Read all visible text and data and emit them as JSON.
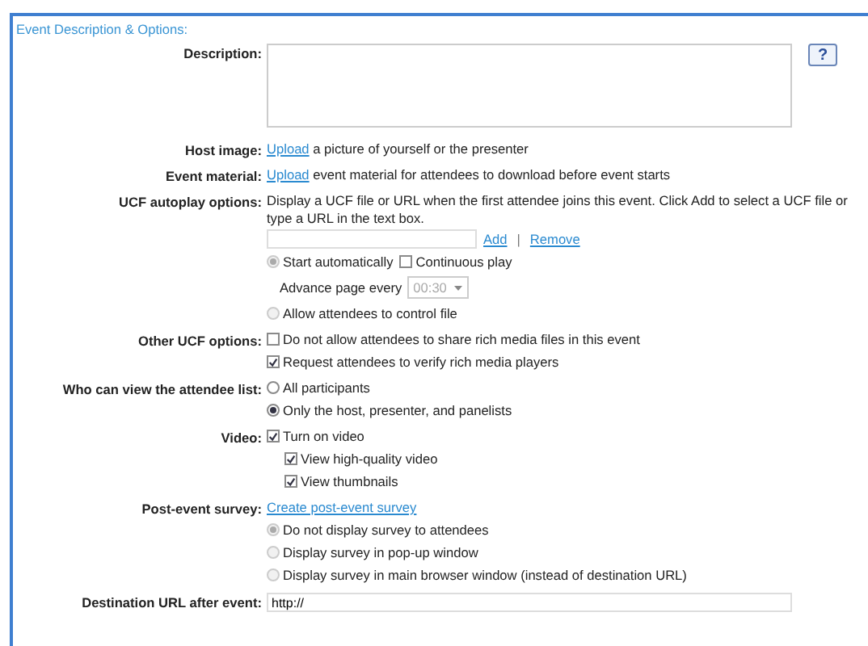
{
  "section_title": "Event Description & Options:",
  "help_button": "?",
  "rows": [
    {
      "label": "Description:",
      "lines": [
        {
          "items": [
            {
              "kind": "textarea"
            }
          ]
        }
      ]
    },
    {
      "label": "Host image:",
      "lines": [
        {
          "items": [
            {
              "kind": "link_text",
              "link": "Upload",
              "text": "a picture of yourself or the presenter"
            }
          ]
        }
      ]
    },
    {
      "label": "Event material:",
      "lines": [
        {
          "items": [
            {
              "kind": "link_text",
              "link": "Upload",
              "text": "event material for attendees to download before event starts"
            }
          ]
        }
      ]
    },
    {
      "label": "UCF autoplay options:",
      "lines": [
        {
          "items": [
            {
              "kind": "note",
              "text": "Display a UCF file or URL when the first attendee joins this event. Click Add to select a UCF file or type a URL in the text box."
            }
          ]
        },
        {
          "items": [
            {
              "kind": "input"
            },
            {
              "kind": "link",
              "text": "Add"
            },
            {
              "kind": "separator",
              "text": "|"
            },
            {
              "kind": "link",
              "text": "Remove"
            }
          ]
        },
        {
          "items": [
            {
              "kind": "radio",
              "label": "Start automatically",
              "checked": true,
              "disabled": true
            },
            {
              "kind": "checkbox",
              "label": "Continuous play",
              "checked": false,
              "disabled": false
            }
          ]
        },
        {
          "items": [
            {
              "kind": "select",
              "label": "Advance page every",
              "value": "00:30",
              "disabled": true
            }
          ]
        },
        {
          "items": [
            {
              "kind": "radio",
              "label": "Allow attendees to control file",
              "checked": false,
              "disabled": true
            }
          ]
        }
      ]
    },
    {
      "label": "Other UCF options:",
      "lines": [
        {
          "items": [
            {
              "kind": "checkbox",
              "label": "Do not allow attendees to share rich media files in this event",
              "checked": false,
              "disabled": false
            }
          ]
        },
        {
          "items": [
            {
              "kind": "checkbox",
              "label": "Request attendees to verify rich media players",
              "checked": true,
              "disabled": false
            }
          ]
        }
      ]
    },
    {
      "label": "Who can view the attendee list:",
      "lines": [
        {
          "items": [
            {
              "kind": "radio",
              "label": "All participants",
              "checked": false,
              "disabled": false
            }
          ]
        },
        {
          "items": [
            {
              "kind": "radio",
              "label": "Only the host, presenter, and panelists",
              "checked": true,
              "disabled": false
            }
          ]
        }
      ]
    },
    {
      "label": "Video:",
      "lines": [
        {
          "items": [
            {
              "kind": "checkbox",
              "label": "Turn on video",
              "checked": true,
              "disabled": false,
              "children": [
                {
                  "items": [
                    {
                      "kind": "checkbox",
                      "label": "View high-quality video",
                      "checked": true,
                      "disabled": false
                    }
                  ]
                },
                {
                  "items": [
                    {
                      "kind": "checkbox",
                      "label": "View thumbnails",
                      "checked": true,
                      "disabled": false
                    }
                  ]
                }
              ]
            }
          ]
        }
      ]
    },
    {
      "label": "Post-event survey:",
      "lines": [
        {
          "items": [
            {
              "kind": "link",
              "text": "Create post-event survey"
            }
          ]
        },
        {
          "items": [
            {
              "kind": "radio",
              "label": "Do not display survey to attendees",
              "checked": true,
              "disabled": true
            }
          ]
        },
        {
          "items": [
            {
              "kind": "radio",
              "label": "Display survey in pop-up window",
              "checked": false,
              "disabled": true
            }
          ]
        },
        {
          "items": [
            {
              "kind": "radio",
              "label": "Display survey in main browser window (instead of destination URL)",
              "checked": false,
              "disabled": true
            }
          ]
        }
      ]
    },
    {
      "label": "Destination URL after event:",
      "lines": [
        {
          "items": [
            {
              "kind": "url_input",
              "value": "http://"
            }
          ]
        }
      ]
    }
  ]
}
